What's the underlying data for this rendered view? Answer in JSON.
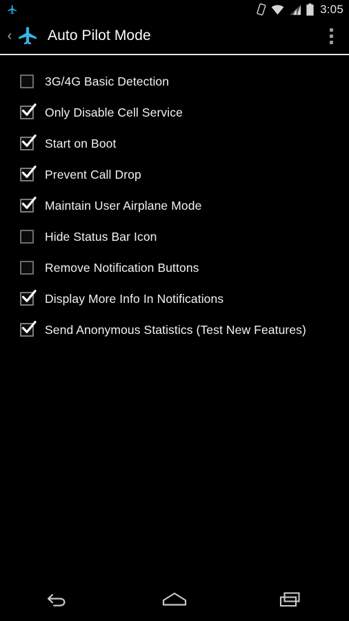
{
  "status_bar": {
    "time": "3:05",
    "left_icons": [
      {
        "name": "airplane-notification-icon",
        "color": "#2aa5d8"
      }
    ],
    "right_icons": [
      {
        "name": "auto-rotate-icon"
      },
      {
        "name": "wifi-icon"
      },
      {
        "name": "cellular-signal-icon"
      },
      {
        "name": "battery-icon"
      }
    ]
  },
  "action_bar": {
    "up_chevron": "‹",
    "app_icon": "airplane-icon",
    "app_icon_color": "#33b5e5",
    "title": "Auto Pilot Mode",
    "overflow_menu": "overflow-menu-icon"
  },
  "preferences": [
    {
      "label": "3G/4G Basic Detection",
      "checked": false,
      "name": "pref-3g-4g-basic-detection"
    },
    {
      "label": "Only Disable Cell Service",
      "checked": true,
      "name": "pref-only-disable-cell-service"
    },
    {
      "label": "Start on Boot",
      "checked": true,
      "name": "pref-start-on-boot"
    },
    {
      "label": "Prevent Call Drop",
      "checked": true,
      "name": "pref-prevent-call-drop"
    },
    {
      "label": "Maintain User Airplane Mode",
      "checked": true,
      "name": "pref-maintain-user-airplane-mode"
    },
    {
      "label": "Hide Status Bar Icon",
      "checked": false,
      "name": "pref-hide-status-bar-icon"
    },
    {
      "label": "Remove Notification Buttons",
      "checked": false,
      "name": "pref-remove-notification-buttons"
    },
    {
      "label": "Display More Info In Notifications",
      "checked": true,
      "name": "pref-display-more-info-in-notifications"
    },
    {
      "label": "Send Anonymous Statistics (Test New Features)",
      "checked": true,
      "name": "pref-send-anonymous-statistics"
    }
  ],
  "nav_bar": {
    "back": "back-icon",
    "home": "home-icon",
    "recents": "recents-icon"
  },
  "colors": {
    "background": "#000000",
    "text": "#f2f2f2",
    "accent": "#33b5e5",
    "divider": "#e9e9e9",
    "checkbox_border": "#6d6d6d"
  }
}
